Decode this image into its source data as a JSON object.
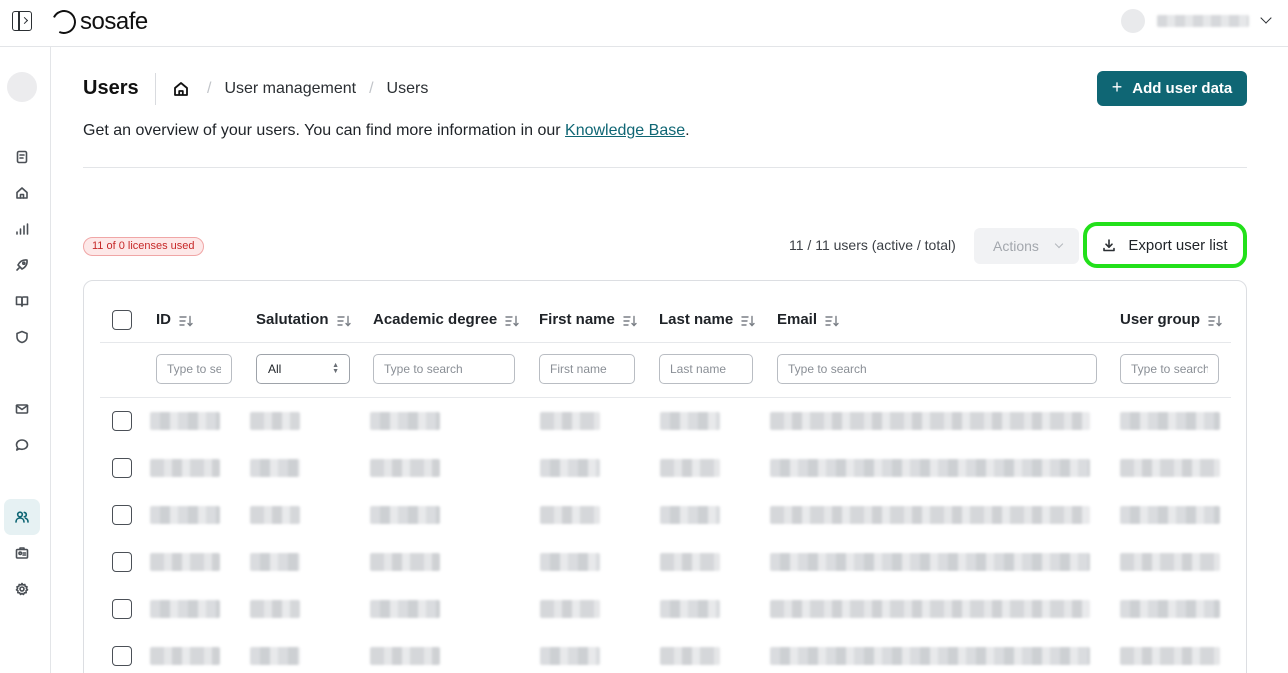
{
  "topbar": {
    "logo_text": "sosafe",
    "icons": {
      "sidebar_toggle": "sidebar-toggle-icon",
      "user_menu": "chevron-down-icon"
    }
  },
  "nav": {
    "items": [
      {
        "name": "nav-item-reports",
        "icon": "clipboard-icon"
      },
      {
        "name": "nav-item-home",
        "icon": "home-icon"
      },
      {
        "name": "nav-item-analytics",
        "icon": "bar-chart-icon"
      },
      {
        "name": "nav-item-launch",
        "icon": "rocket-icon"
      },
      {
        "name": "nav-item-learning",
        "icon": "book-icon"
      },
      {
        "name": "nav-item-security",
        "icon": "shield-icon"
      },
      {
        "name": "nav-item-mail",
        "icon": "mail-icon"
      },
      {
        "name": "nav-item-chat",
        "icon": "chat-icon"
      },
      {
        "name": "nav-item-users",
        "icon": "users-icon",
        "active": true
      },
      {
        "name": "nav-item-id",
        "icon": "id-card-icon"
      },
      {
        "name": "nav-item-settings",
        "icon": "gear-icon"
      }
    ]
  },
  "header": {
    "title": "Users",
    "breadcrumb": [
      "User management",
      "Users"
    ],
    "add_button": "Add user data",
    "description_prefix": "Get an overview of your users. You can find more information in our ",
    "description_link": "Knowledge Base",
    "description_suffix": "."
  },
  "toolbar": {
    "license_badge": "11 of 0 licenses used",
    "user_count": "11 / 11 users (active / total)",
    "actions_label": "Actions",
    "export_label": "Export user list"
  },
  "table": {
    "columns": [
      {
        "key": "id",
        "label": "ID",
        "filter_type": "input",
        "placeholder": "Type to search"
      },
      {
        "key": "salutation",
        "label": "Salutation",
        "filter_type": "select",
        "value": "All"
      },
      {
        "key": "academic_degree",
        "label": "Academic degree",
        "filter_type": "input",
        "placeholder": "Type to search"
      },
      {
        "key": "first_name",
        "label": "First name",
        "filter_type": "input",
        "placeholder": "First name"
      },
      {
        "key": "last_name",
        "label": "Last name",
        "filter_type": "input",
        "placeholder": "Last name"
      },
      {
        "key": "email",
        "label": "Email",
        "filter_type": "input",
        "placeholder": "Type to search"
      },
      {
        "key": "user_group",
        "label": "User group",
        "filter_type": "input",
        "placeholder": "Type to search"
      }
    ],
    "row_count_visible": 6
  },
  "colors": {
    "accent": "#0f6674",
    "highlight": "#22e01a",
    "badge_text": "#c62828",
    "badge_bg": "#fde8e8"
  }
}
